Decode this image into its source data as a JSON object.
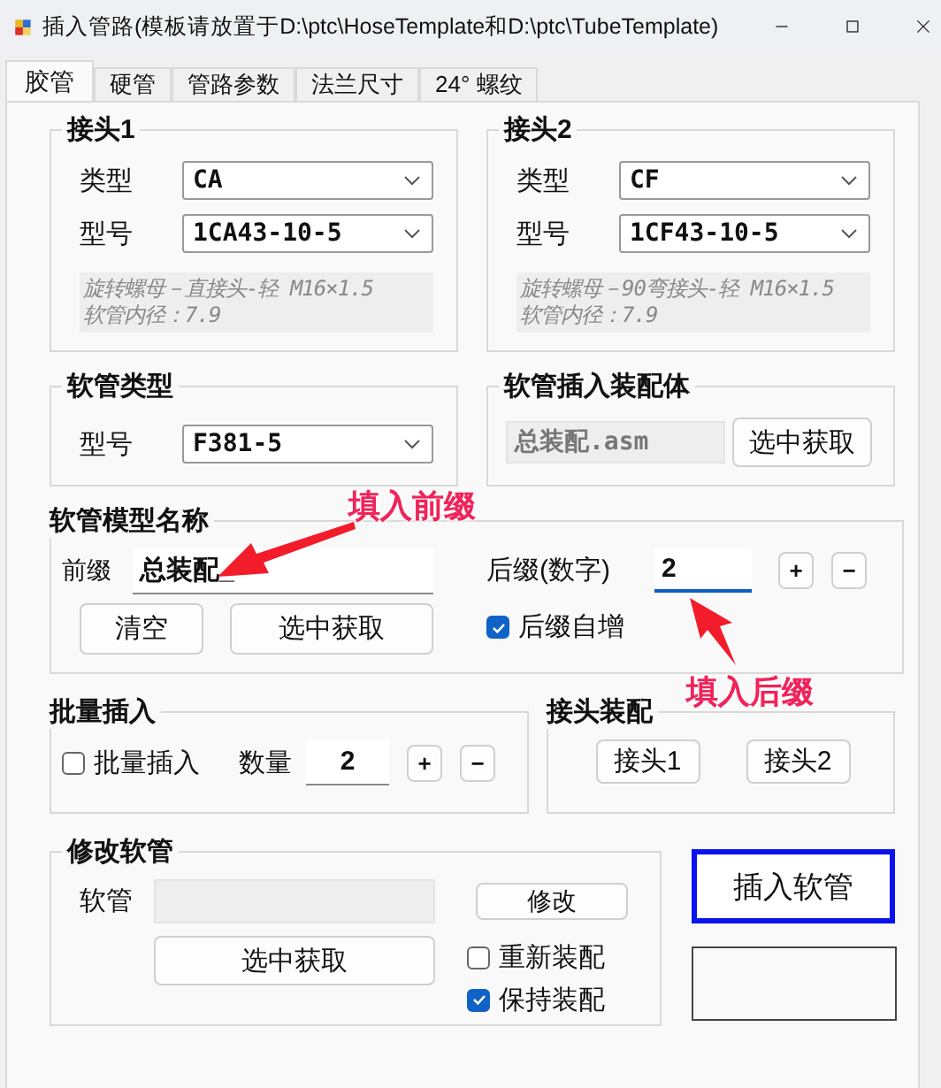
{
  "window": {
    "title": "插入管路(模板请放置于D:\\ptc\\HoseTemplate和D:\\ptc\\TubeTemplate)"
  },
  "tabs": [
    {
      "label": "胶管",
      "selected": true
    },
    {
      "label": "硬管",
      "selected": false
    },
    {
      "label": "管路参数",
      "selected": false
    },
    {
      "label": "法兰尺寸",
      "selected": false
    },
    {
      "label": "24° 螺纹",
      "selected": false
    }
  ],
  "joints": [
    {
      "title": "接头1",
      "type_label": "类型",
      "type_value": "CA",
      "model_label": "型号",
      "model_value": "1CA43-10-5",
      "info": [
        "旋转螺母－直接头-轻 M16×1.5",
        "软管内径：7.9"
      ]
    },
    {
      "title": "接头2",
      "type_label": "类型",
      "type_value": "CF",
      "model_label": "型号",
      "model_value": "1CF43-10-5",
      "info": [
        "旋转螺母－90弯接头-轻 M16×1.5",
        "软管内径：7.9"
      ]
    }
  ],
  "hose_type": {
    "title": "软管类型",
    "model_label": "型号",
    "model_value": "F381-5"
  },
  "assembly": {
    "title": "软管插入装配体",
    "value": "总装配.asm",
    "button": "选中获取"
  },
  "model_name": {
    "title": "软管模型名称",
    "prefix_label": "前缀",
    "prefix_value": "总装配_",
    "clear_button": "清空",
    "pick_button": "选中获取",
    "suffix_label": "后缀(数字)",
    "suffix_value": "2",
    "suffix_focused": true,
    "plus": "+",
    "minus": "−",
    "auto_increment": {
      "label": "后缀自增",
      "checked": true
    }
  },
  "batch": {
    "title": "批量插入",
    "checkbox": {
      "label": "批量插入",
      "checked": false
    },
    "count_label": "数量",
    "count_value": "2",
    "plus": "+",
    "minus": "−"
  },
  "joint_assembly": {
    "title": "接头装配",
    "buttons": [
      "接头1",
      "接头2"
    ]
  },
  "modify": {
    "title": "修改软管",
    "hose_label": "软管",
    "modify_button": "修改",
    "pick_button": "选中获取",
    "options": [
      {
        "label": "重新装配",
        "checked": false
      },
      {
        "label": "保持装配",
        "checked": true
      }
    ]
  },
  "insert_button": "插入软管",
  "annotations": [
    {
      "text": "填入前缀"
    },
    {
      "text": "填入后缀"
    }
  ]
}
